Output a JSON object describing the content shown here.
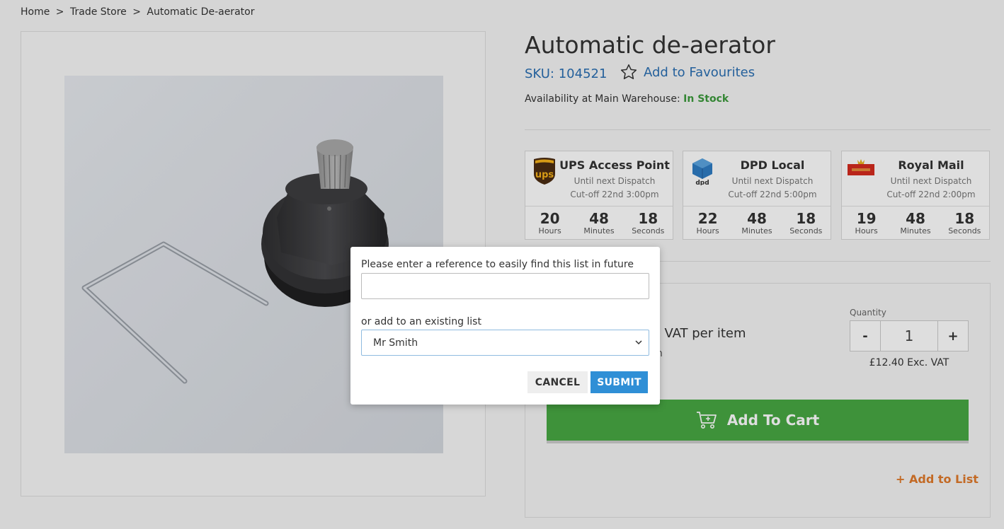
{
  "breadcrumb": {
    "home": "Home",
    "sep1": ">",
    "trade": "Trade Store",
    "sep2": ">",
    "current": "Automatic De-aerator"
  },
  "product": {
    "title": "Automatic de-aerator",
    "sku": "SKU: 104521",
    "favourites": "Add to Favourites",
    "availability_label": "Availability at Main Warehouse:",
    "availability_status": "In Stock"
  },
  "carriers": [
    {
      "name": "UPS Access Point",
      "line1": "Until next Dispatch",
      "line2": "Cut-off 22nd 3:00pm",
      "hours": "20",
      "minutes": "48",
      "seconds": "18",
      "logo": "ups-logo"
    },
    {
      "name": "DPD Local",
      "line1": "Until next Dispatch",
      "line2": "Cut-off 22nd 5:00pm",
      "hours": "22",
      "minutes": "48",
      "seconds": "18",
      "logo": "dpd-logo"
    },
    {
      "name": "Royal Mail",
      "line1": "Until next Dispatch",
      "line2": "Cut-off 22nd 2:00pm",
      "hours": "19",
      "minutes": "48",
      "seconds": "18",
      "logo": "royal-mail-logo"
    }
  ],
  "units": {
    "hours": "Hours",
    "minutes": "Minutes",
    "seconds": "Seconds"
  },
  "purchase": {
    "price_line": ". VAT per item",
    "price_sub": "n",
    "quantity_label": "Quantity",
    "quantity_value": "1",
    "minus": "-",
    "plus": "+",
    "unit_price": "£12.40 Exc. VAT",
    "add_to_cart": "Add To Cart",
    "add_to_list": "+ Add to List"
  },
  "modal": {
    "reference_label": "Please enter a reference to easily find this list in future",
    "reference_value": "",
    "existing_label": "or add to an existing list",
    "selected_list": "Mr Smith",
    "cancel": "CANCEL",
    "submit": "SUBMIT"
  },
  "colors": {
    "link_blue": "#2a6fb3",
    "in_stock_green": "#3c9a3c",
    "cart_green": "#48a843",
    "list_orange": "#e07a2b",
    "submit_blue": "#2f8fd6"
  }
}
